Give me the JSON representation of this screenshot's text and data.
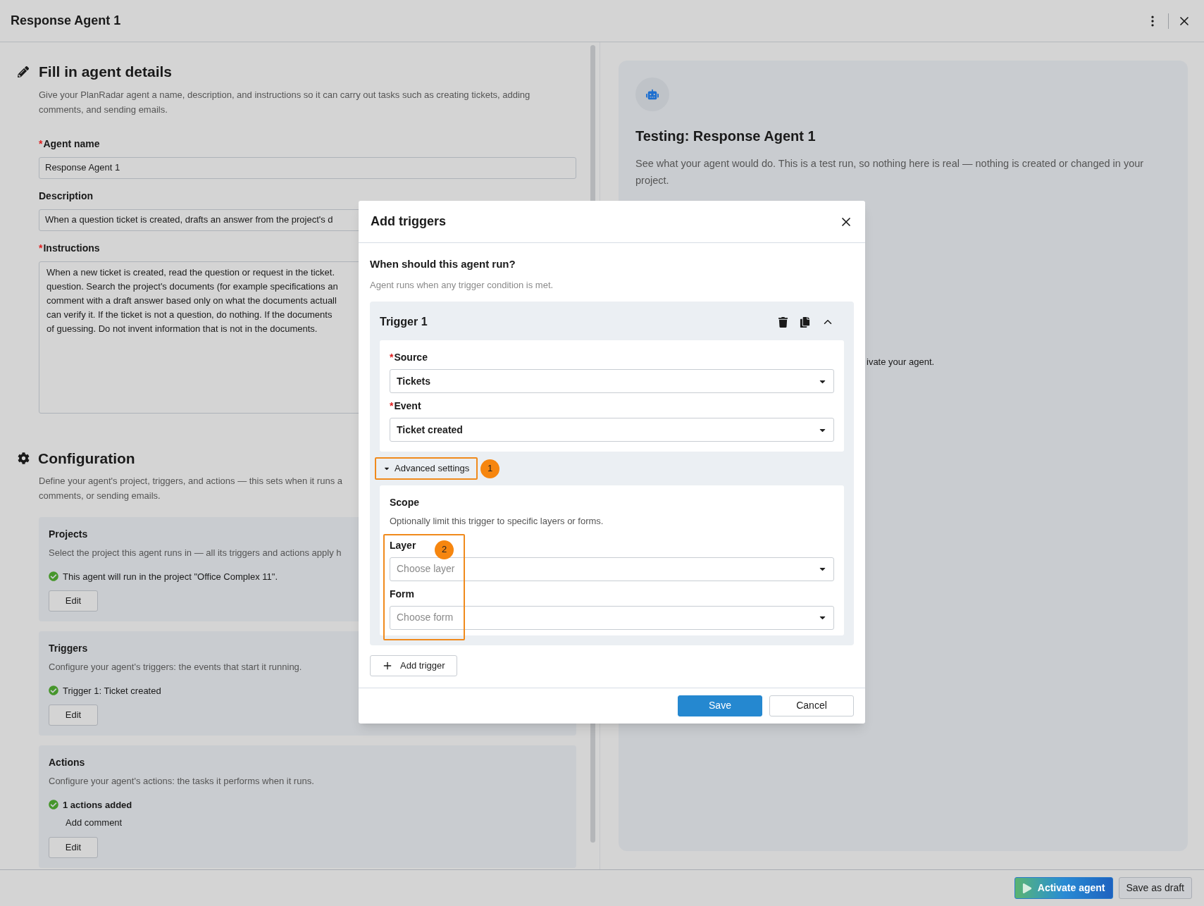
{
  "window": {
    "title": "Response Agent 1"
  },
  "details": {
    "heading": "Fill in agent details",
    "description": "Give your PlanRadar agent a name, description, and instructions so it can carry out tasks such as creating tickets, adding comments, and sending emails.",
    "fields": [
      {
        "kind": "input",
        "label": "Agent name",
        "required_mark": "*",
        "lines": [
          "Response Agent 1"
        ]
      },
      {
        "kind": "input",
        "label": "Description",
        "lines": [
          "When a question ticket is created, drafts an answer from the project's d"
        ]
      },
      {
        "kind": "textarea",
        "label": "Instructions",
        "required_mark": "*",
        "lines": [
          "When a new ticket is created, read the question or request in the ticket.",
          "question. Search the project's documents (for example specifications an",
          "comment with a draft answer based only on what the documents actuall",
          "can verify it. If the ticket is not a question, do nothing. If the documents",
          "of guessing. Do not invent information that is not in the documents."
        ]
      }
    ]
  },
  "configuration": {
    "heading": "Configuration",
    "description_lines": [
      "Define your agent's project, triggers, and actions — this sets when it runs a",
      "comments, or sending emails."
    ],
    "sections": [
      {
        "title": "Projects",
        "description": "Select the project this agent runs in — all its triggers and actions apply h",
        "status": "This agent will run in the project \"Office Complex 11\".",
        "bold": false,
        "button": "Edit"
      },
      {
        "title": "Triggers",
        "description": "Configure your agent's triggers: the events that start it running.",
        "status": "Trigger 1: Ticket created",
        "bold": false,
        "button": "Edit"
      },
      {
        "title": "Actions",
        "description": "Configure your agent's actions: the tasks it performs when it runs.",
        "status": "1 actions added",
        "bold": true,
        "detail": "Add comment",
        "button": "Edit"
      }
    ]
  },
  "testing": {
    "title": "Testing: Response Agent 1",
    "description": "See what your agent would do. This is a test run, so nothing here is real — nothing is created or changed in your project.",
    "note": "ivate your agent."
  },
  "modal": {
    "title": "Add triggers",
    "question": "When should this agent run?",
    "hint": "Agent runs when any trigger condition is met.",
    "triggers": [
      {
        "title": "Trigger 1",
        "expanded": true,
        "fields": [
          {
            "label": "Source",
            "required_mark": "*",
            "value": "Tickets"
          },
          {
            "label": "Event",
            "required_mark": "*",
            "value": "Ticket created"
          }
        ],
        "advanced": {
          "label": "Advanced settings",
          "expanded": true,
          "annotation": "1",
          "scope_title": "Scope",
          "scope_hint": "Optionally limit this trigger to specific layers or forms.",
          "annotation_fields": "2",
          "fields": [
            {
              "label": "Layer",
              "placeholder": "Choose layer"
            },
            {
              "label": "Form",
              "placeholder": "Choose form"
            }
          ]
        }
      }
    ],
    "add_button": "Add trigger",
    "buttons": [
      {
        "label": "Save",
        "kind": "primary"
      },
      {
        "label": "Cancel",
        "kind": "secondary"
      }
    ]
  },
  "footer": {
    "buttons": [
      {
        "label": "Activate agent",
        "kind": "primary"
      },
      {
        "label": "Save as draft",
        "kind": "secondary"
      }
    ]
  }
}
